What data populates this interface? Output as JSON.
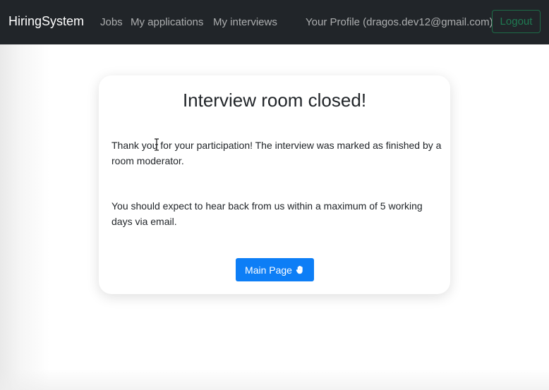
{
  "navbar": {
    "brand": "HiringSystem",
    "links": [
      {
        "label": "Jobs"
      },
      {
        "label": "My applications"
      },
      {
        "label": "My interviews"
      }
    ],
    "profile_label": "Your Profile (dragos.dev12@gmail.com)",
    "logout_label": "Logout",
    "background_color": "#212529",
    "logout_color": "#198754"
  },
  "card": {
    "title": "Interview room closed!",
    "paragraphs": [
      "Thank you for your participation! The interview was marked as finished by a room moderator.",
      "You should expect to hear back from us within a maximum of 5 working days via email."
    ],
    "button_label": "Main Page",
    "button_icon": "hand-icon",
    "button_color": "#0d6efd"
  },
  "overlay": {
    "cursor_icon": "text-cursor-icon"
  }
}
